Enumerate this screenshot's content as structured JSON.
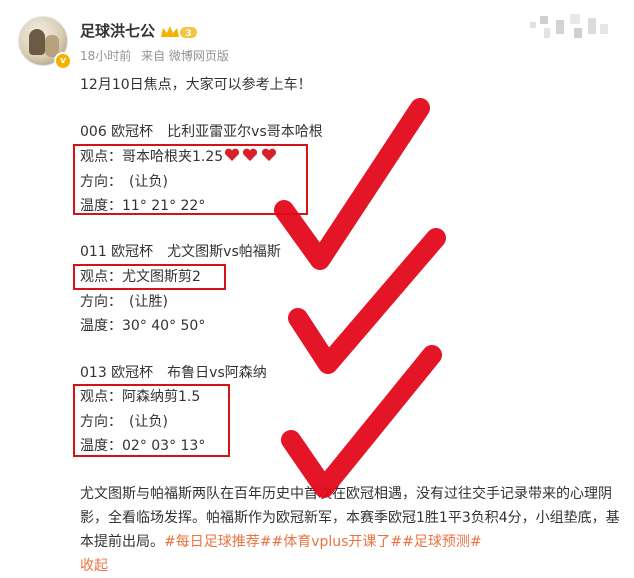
{
  "post": {
    "username": "足球洪七公",
    "vip_level": "3",
    "time": "18小时前",
    "source": "来自 微博网页版",
    "intro": "12月10日焦点，大家可以参考上车！",
    "matches": [
      {
        "title": "006 欧冠杯　比利亚雷亚尔vs哥本哈根",
        "view": "观点：哥本哈根夹1.25",
        "direction": "方向：　(让负)",
        "temperature": "温度：11° 21° 22°"
      },
      {
        "title": "011 欧冠杯　尤文图斯vs帕福斯",
        "view": "观点：尤文图斯剪2",
        "direction": "方向：　(让胜)",
        "temperature": "温度：30° 40° 50°"
      },
      {
        "title": "013 欧冠杯　布鲁日vs阿森纳",
        "view": "观点：阿森纳剪1.5",
        "direction": "方向：　(让负)",
        "temperature": "温度：02° 03° 13°"
      }
    ],
    "paragraph": "尤文图斯与帕福斯两队在百年历史中首次在欧冠相遇，没有过往交手记录带来的心理阴影，全看临场发挥。帕福斯作为欧冠新军，本赛季欧冠1胜1平3负积4分，小组垫底，基本提前出局。",
    "tags": [
      "#每日足球推荐#",
      "#体育vplus开课了#",
      "#足球预测#"
    ],
    "collapse": "收起"
  },
  "colors": {
    "annotation_red": "#d21414",
    "heart_red": "#d91f2a",
    "tag_orange": "#eb7340",
    "meta_gray": "#939393",
    "vip_gold": "#f5b300"
  }
}
